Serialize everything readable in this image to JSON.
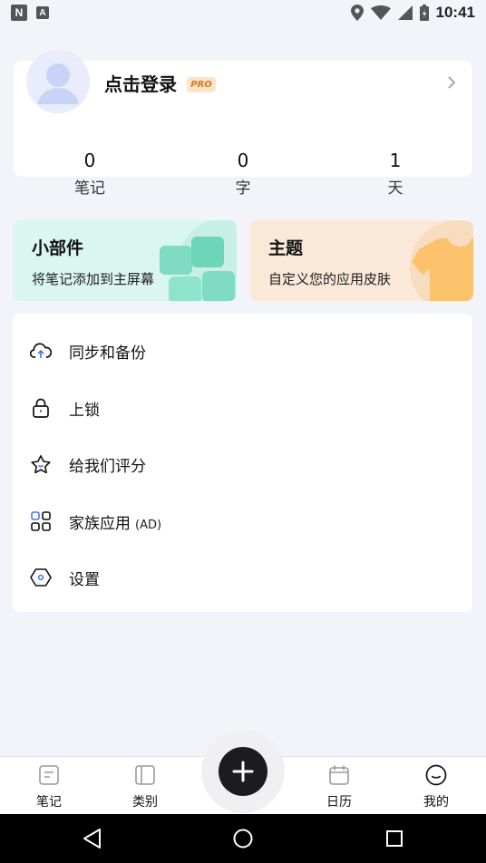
{
  "status_bar": {
    "left_icons": [
      {
        "icon": "n-notification-icon",
        "text": "N"
      },
      {
        "icon": "a-notification-icon",
        "text": "A"
      }
    ],
    "right_icons": [
      "location-icon",
      "wifi-icon",
      "signal-icon",
      "battery-charging-icon"
    ],
    "time": "10:41"
  },
  "profile": {
    "login_label": "点击登录",
    "pro_badge": "PRO",
    "stats": [
      {
        "value": "0",
        "label": "笔记"
      },
      {
        "value": "0",
        "label": "字"
      },
      {
        "value": "1",
        "label": "天"
      }
    ]
  },
  "tiles": [
    {
      "title": "小部件",
      "subtitle": "将笔记添加到主屏幕",
      "color": "#dbf5ef"
    },
    {
      "title": "主题",
      "subtitle": "自定义您的应用皮肤",
      "color": "#fae8d8"
    }
  ],
  "menu": [
    {
      "label": "同步和备份",
      "icon": "cloud-upload-icon"
    },
    {
      "label": "上锁",
      "icon": "lock-icon"
    },
    {
      "label": "给我们评分",
      "icon": "star-icon"
    },
    {
      "label": "家族应用",
      "suffix": "(AD)",
      "icon": "apps-grid-icon"
    },
    {
      "label": "设置",
      "icon": "settings-hexagon-icon"
    }
  ],
  "bottom_nav": [
    {
      "label": "笔记",
      "icon": "notes-icon"
    },
    {
      "label": "类别",
      "icon": "category-icon"
    },
    {
      "label": "日历",
      "icon": "calendar-icon"
    },
    {
      "label": "我的",
      "icon": "smile-icon"
    }
  ],
  "fab": {
    "icon": "plus-icon"
  },
  "system_nav": [
    "back-icon",
    "home-icon",
    "recents-icon"
  ],
  "colors": {
    "background": "#f3f4fa",
    "fab": "#1c1c1f",
    "pro_badge": "#fbe4c8",
    "accent_blue": "#4a78e8"
  }
}
